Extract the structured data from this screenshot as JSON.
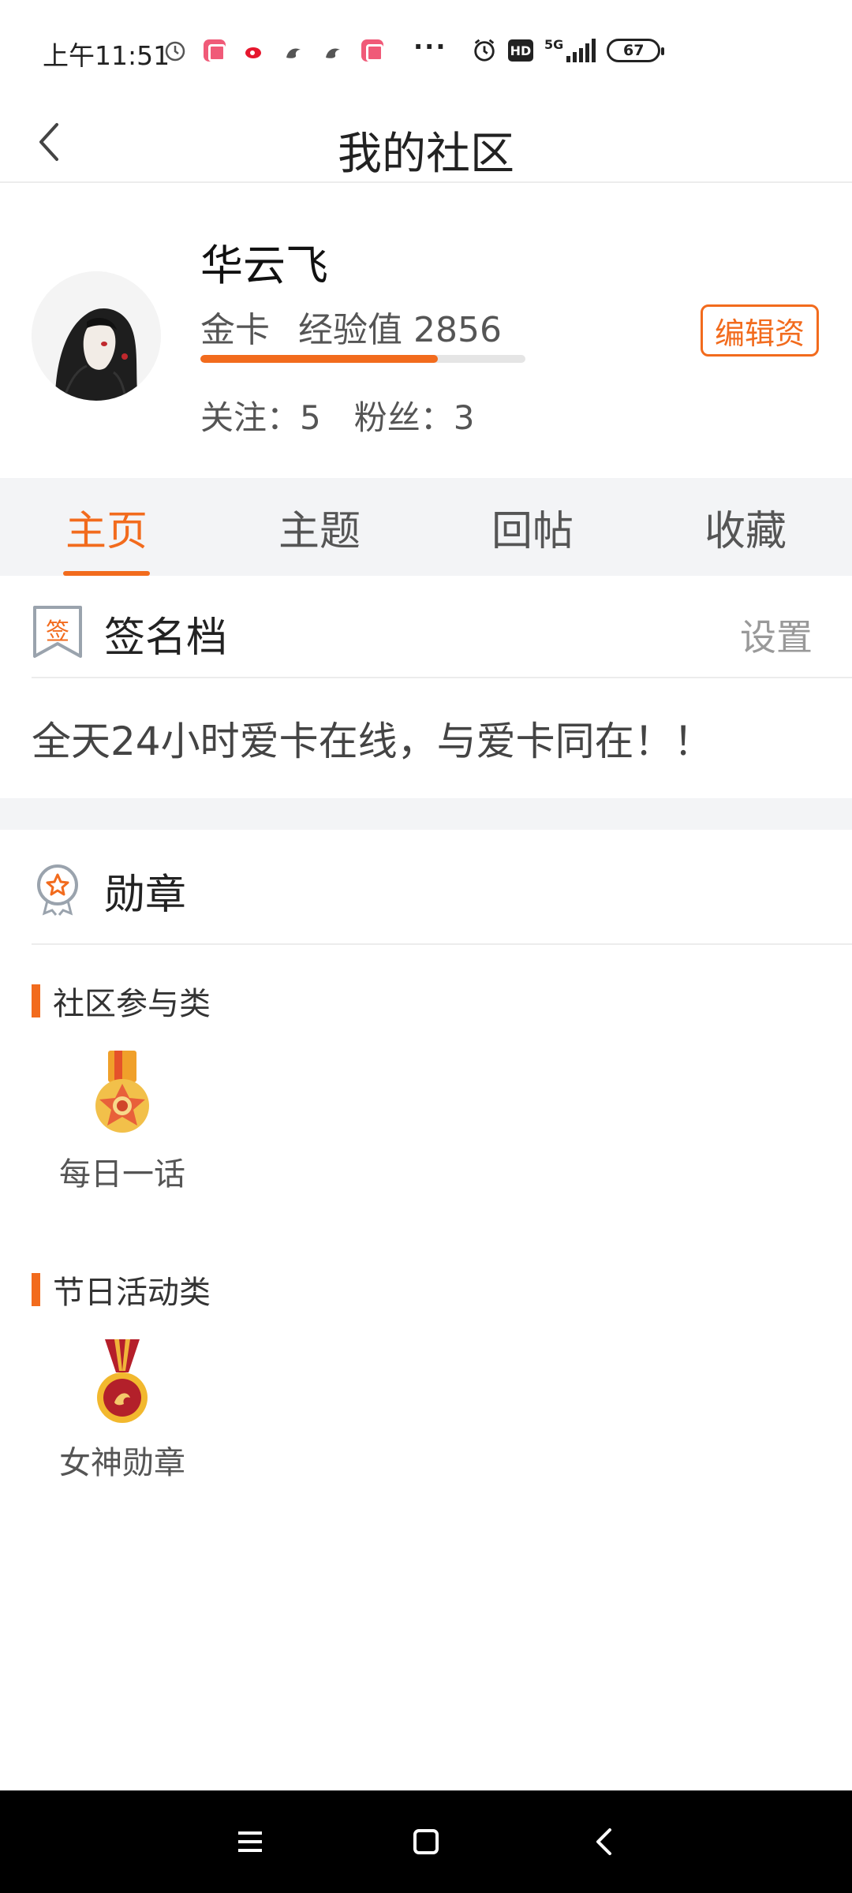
{
  "status_bar": {
    "time": "上午11:51",
    "network": "5G",
    "hd": "HD",
    "battery": "67"
  },
  "nav": {
    "title": "我的社区"
  },
  "profile": {
    "name": "华云飞",
    "level": "金卡",
    "exp_label": "经验值",
    "exp_value": "2856",
    "exp_progress": 0.73,
    "follow_label": "关注：",
    "follow_count": "5",
    "fans_label": "粉丝：",
    "fans_count": "3",
    "edit_button": "编辑资"
  },
  "tabs": [
    {
      "label": "主页",
      "active": true
    },
    {
      "label": "主题",
      "active": false
    },
    {
      "label": "回帖",
      "active": false
    },
    {
      "label": "收藏",
      "active": false
    }
  ],
  "signature": {
    "icon_char": "签",
    "title": "签名档",
    "action": "设置",
    "text": "全天24小时爱卡在线，与爱卡同在！！"
  },
  "badges": {
    "title": "勋章",
    "categories": [
      {
        "name": "社区参与类",
        "items": [
          {
            "label": "每日一话",
            "icon": "daily-talk-medal-icon"
          }
        ]
      },
      {
        "name": "节日活动类",
        "items": [
          {
            "label": "女神勋章",
            "icon": "goddess-medal-icon"
          }
        ]
      }
    ]
  },
  "colors": {
    "accent": "#f26b1d",
    "tab_bg": "#f3f4f6"
  }
}
